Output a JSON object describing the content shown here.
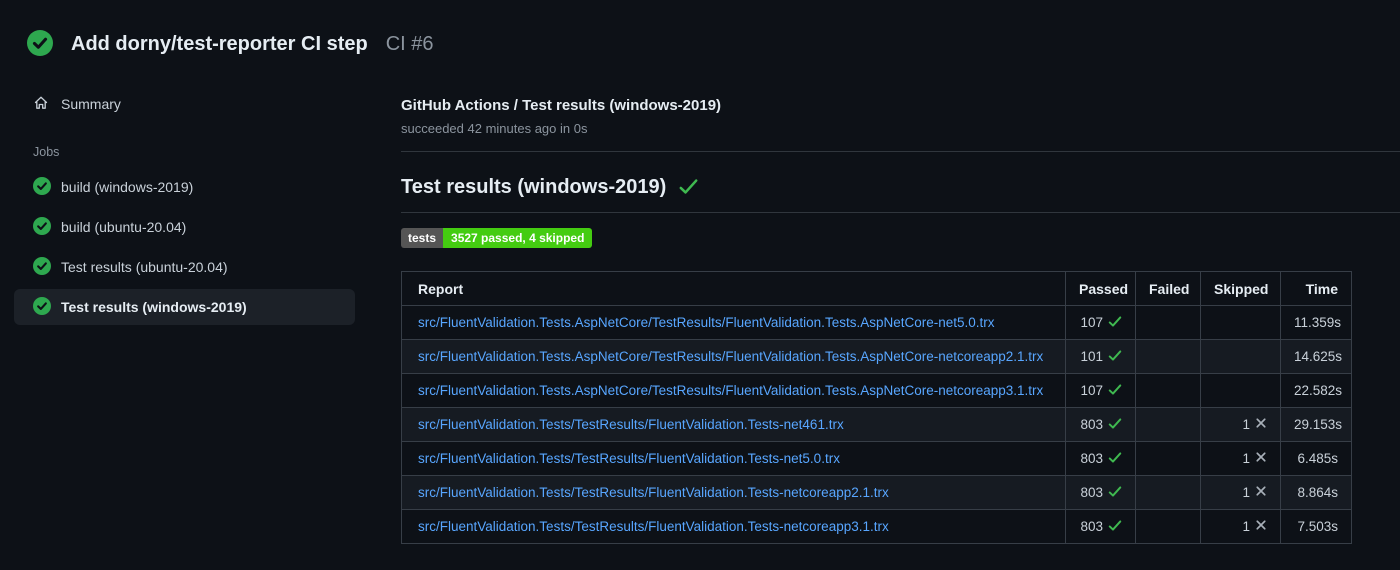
{
  "header": {
    "title": "Add dorny/test-reporter CI step",
    "run_number": "CI #6",
    "status_icon": "check-circle-icon"
  },
  "sidebar": {
    "summary_label": "Summary",
    "jobs_label": "Jobs",
    "jobs": [
      {
        "label": "build (windows-2019)",
        "status": "success",
        "selected": false
      },
      {
        "label": "build (ubuntu-20.04)",
        "status": "success",
        "selected": false
      },
      {
        "label": "Test results (ubuntu-20.04)",
        "status": "success",
        "selected": false
      },
      {
        "label": "Test results (windows-2019)",
        "status": "success",
        "selected": true
      }
    ]
  },
  "main": {
    "check_title": "GitHub Actions / Test results (windows-2019)",
    "check_status": "succeeded 42 minutes ago in 0s",
    "section_title": "Test results (windows-2019)",
    "badge": {
      "label": "tests",
      "value": "3527 passed, 4 skipped"
    },
    "table": {
      "columns": [
        "Report",
        "Passed",
        "Failed",
        "Skipped",
        "Time"
      ],
      "rows": [
        {
          "report": "src/FluentValidation.Tests.AspNetCore/TestResults/FluentValidation.Tests.AspNetCore-net5.0.trx",
          "passed": "107",
          "failed": "",
          "skipped": "",
          "time": "11.359s"
        },
        {
          "report": "src/FluentValidation.Tests.AspNetCore/TestResults/FluentValidation.Tests.AspNetCore-netcoreapp2.1.trx",
          "passed": "101",
          "failed": "",
          "skipped": "",
          "time": "14.625s"
        },
        {
          "report": "src/FluentValidation.Tests.AspNetCore/TestResults/FluentValidation.Tests.AspNetCore-netcoreapp3.1.trx",
          "passed": "107",
          "failed": "",
          "skipped": "",
          "time": "22.582s"
        },
        {
          "report": "src/FluentValidation.Tests/TestResults/FluentValidation.Tests-net461.trx",
          "passed": "803",
          "failed": "",
          "skipped": "1",
          "time": "29.153s"
        },
        {
          "report": "src/FluentValidation.Tests/TestResults/FluentValidation.Tests-net5.0.trx",
          "passed": "803",
          "failed": "",
          "skipped": "1",
          "time": "6.485s"
        },
        {
          "report": "src/FluentValidation.Tests/TestResults/FluentValidation.Tests-netcoreapp2.1.trx",
          "passed": "803",
          "failed": "",
          "skipped": "1",
          "time": "8.864s"
        },
        {
          "report": "src/FluentValidation.Tests/TestResults/FluentValidation.Tests-netcoreapp3.1.trx",
          "passed": "803",
          "failed": "",
          "skipped": "1",
          "time": "7.503s"
        }
      ]
    }
  },
  "colors": {
    "background": "#0d1117",
    "success_circle": "#2ea84f",
    "success_check": "#3fb950",
    "link_blue": "#58a6ff",
    "badge_label_bg": "#555555",
    "badge_value_bg": "#44cc11",
    "row_alt_bg": "#161b22",
    "table_border": "#373e47",
    "x_mark_gray": "#a8b0b9"
  }
}
